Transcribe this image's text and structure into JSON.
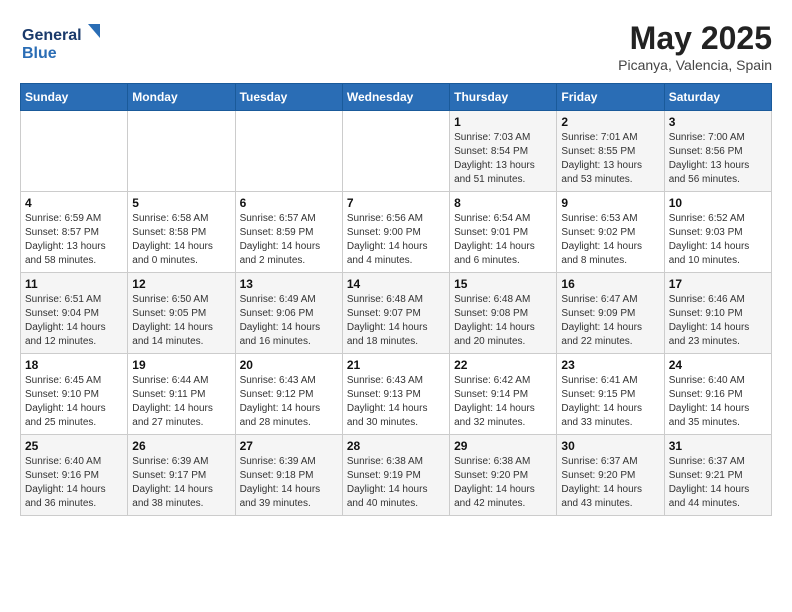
{
  "header": {
    "logo_line1": "General",
    "logo_line2": "Blue",
    "month": "May 2025",
    "location": "Picanya, Valencia, Spain"
  },
  "weekdays": [
    "Sunday",
    "Monday",
    "Tuesday",
    "Wednesday",
    "Thursday",
    "Friday",
    "Saturday"
  ],
  "weeks": [
    [
      {
        "day": "",
        "info": ""
      },
      {
        "day": "",
        "info": ""
      },
      {
        "day": "",
        "info": ""
      },
      {
        "day": "",
        "info": ""
      },
      {
        "day": "1",
        "info": "Sunrise: 7:03 AM\nSunset: 8:54 PM\nDaylight: 13 hours\nand 51 minutes."
      },
      {
        "day": "2",
        "info": "Sunrise: 7:01 AM\nSunset: 8:55 PM\nDaylight: 13 hours\nand 53 minutes."
      },
      {
        "day": "3",
        "info": "Sunrise: 7:00 AM\nSunset: 8:56 PM\nDaylight: 13 hours\nand 56 minutes."
      }
    ],
    [
      {
        "day": "4",
        "info": "Sunrise: 6:59 AM\nSunset: 8:57 PM\nDaylight: 13 hours\nand 58 minutes."
      },
      {
        "day": "5",
        "info": "Sunrise: 6:58 AM\nSunset: 8:58 PM\nDaylight: 14 hours\nand 0 minutes."
      },
      {
        "day": "6",
        "info": "Sunrise: 6:57 AM\nSunset: 8:59 PM\nDaylight: 14 hours\nand 2 minutes."
      },
      {
        "day": "7",
        "info": "Sunrise: 6:56 AM\nSunset: 9:00 PM\nDaylight: 14 hours\nand 4 minutes."
      },
      {
        "day": "8",
        "info": "Sunrise: 6:54 AM\nSunset: 9:01 PM\nDaylight: 14 hours\nand 6 minutes."
      },
      {
        "day": "9",
        "info": "Sunrise: 6:53 AM\nSunset: 9:02 PM\nDaylight: 14 hours\nand 8 minutes."
      },
      {
        "day": "10",
        "info": "Sunrise: 6:52 AM\nSunset: 9:03 PM\nDaylight: 14 hours\nand 10 minutes."
      }
    ],
    [
      {
        "day": "11",
        "info": "Sunrise: 6:51 AM\nSunset: 9:04 PM\nDaylight: 14 hours\nand 12 minutes."
      },
      {
        "day": "12",
        "info": "Sunrise: 6:50 AM\nSunset: 9:05 PM\nDaylight: 14 hours\nand 14 minutes."
      },
      {
        "day": "13",
        "info": "Sunrise: 6:49 AM\nSunset: 9:06 PM\nDaylight: 14 hours\nand 16 minutes."
      },
      {
        "day": "14",
        "info": "Sunrise: 6:48 AM\nSunset: 9:07 PM\nDaylight: 14 hours\nand 18 minutes."
      },
      {
        "day": "15",
        "info": "Sunrise: 6:48 AM\nSunset: 9:08 PM\nDaylight: 14 hours\nand 20 minutes."
      },
      {
        "day": "16",
        "info": "Sunrise: 6:47 AM\nSunset: 9:09 PM\nDaylight: 14 hours\nand 22 minutes."
      },
      {
        "day": "17",
        "info": "Sunrise: 6:46 AM\nSunset: 9:10 PM\nDaylight: 14 hours\nand 23 minutes."
      }
    ],
    [
      {
        "day": "18",
        "info": "Sunrise: 6:45 AM\nSunset: 9:10 PM\nDaylight: 14 hours\nand 25 minutes."
      },
      {
        "day": "19",
        "info": "Sunrise: 6:44 AM\nSunset: 9:11 PM\nDaylight: 14 hours\nand 27 minutes."
      },
      {
        "day": "20",
        "info": "Sunrise: 6:43 AM\nSunset: 9:12 PM\nDaylight: 14 hours\nand 28 minutes."
      },
      {
        "day": "21",
        "info": "Sunrise: 6:43 AM\nSunset: 9:13 PM\nDaylight: 14 hours\nand 30 minutes."
      },
      {
        "day": "22",
        "info": "Sunrise: 6:42 AM\nSunset: 9:14 PM\nDaylight: 14 hours\nand 32 minutes."
      },
      {
        "day": "23",
        "info": "Sunrise: 6:41 AM\nSunset: 9:15 PM\nDaylight: 14 hours\nand 33 minutes."
      },
      {
        "day": "24",
        "info": "Sunrise: 6:40 AM\nSunset: 9:16 PM\nDaylight: 14 hours\nand 35 minutes."
      }
    ],
    [
      {
        "day": "25",
        "info": "Sunrise: 6:40 AM\nSunset: 9:16 PM\nDaylight: 14 hours\nand 36 minutes."
      },
      {
        "day": "26",
        "info": "Sunrise: 6:39 AM\nSunset: 9:17 PM\nDaylight: 14 hours\nand 38 minutes."
      },
      {
        "day": "27",
        "info": "Sunrise: 6:39 AM\nSunset: 9:18 PM\nDaylight: 14 hours\nand 39 minutes."
      },
      {
        "day": "28",
        "info": "Sunrise: 6:38 AM\nSunset: 9:19 PM\nDaylight: 14 hours\nand 40 minutes."
      },
      {
        "day": "29",
        "info": "Sunrise: 6:38 AM\nSunset: 9:20 PM\nDaylight: 14 hours\nand 42 minutes."
      },
      {
        "day": "30",
        "info": "Sunrise: 6:37 AM\nSunset: 9:20 PM\nDaylight: 14 hours\nand 43 minutes."
      },
      {
        "day": "31",
        "info": "Sunrise: 6:37 AM\nSunset: 9:21 PM\nDaylight: 14 hours\nand 44 minutes."
      }
    ]
  ]
}
